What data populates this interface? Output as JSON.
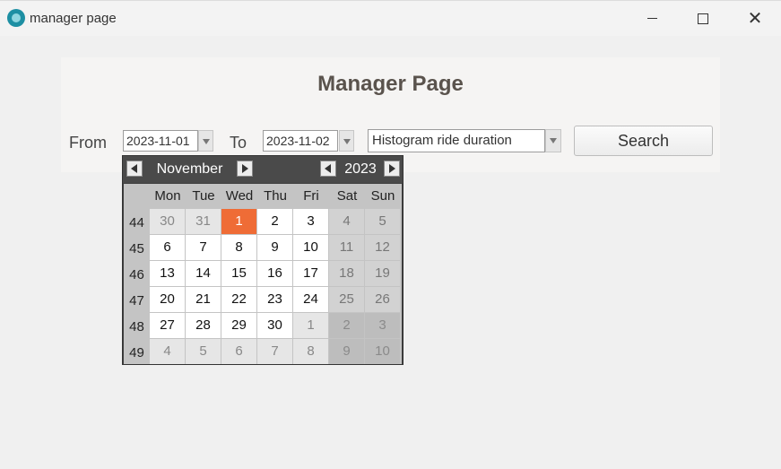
{
  "window": {
    "title": "manager page",
    "icon": "app-logo-icon",
    "controls": {
      "minimize": "minimize-icon",
      "maximize": "maximize-icon",
      "close": "close-icon"
    }
  },
  "page": {
    "title": "Manager Page",
    "from_label": "From",
    "to_label": "To",
    "from_date": "2023-11-01",
    "to_date": "2023-11-02",
    "report_type": "Histogram ride duration",
    "search_label": "Search"
  },
  "calendar": {
    "month": "November",
    "year": "2023",
    "weekday_headers": [
      "Mon",
      "Tue",
      "Wed",
      "Thu",
      "Fri",
      "Sat",
      "Sun"
    ],
    "selected_day": "1",
    "colors": {
      "selected": "#ef6c36",
      "header": "#4a4a4a"
    },
    "weeks": [
      {
        "week": "44",
        "days": [
          {
            "d": "30",
            "in": false
          },
          {
            "d": "31",
            "in": false
          },
          {
            "d": "1",
            "in": true
          },
          {
            "d": "2",
            "in": true
          },
          {
            "d": "3",
            "in": true
          },
          {
            "d": "4",
            "in": true
          },
          {
            "d": "5",
            "in": true
          }
        ]
      },
      {
        "week": "45",
        "days": [
          {
            "d": "6",
            "in": true
          },
          {
            "d": "7",
            "in": true
          },
          {
            "d": "8",
            "in": true
          },
          {
            "d": "9",
            "in": true
          },
          {
            "d": "10",
            "in": true
          },
          {
            "d": "11",
            "in": true
          },
          {
            "d": "12",
            "in": true
          }
        ]
      },
      {
        "week": "46",
        "days": [
          {
            "d": "13",
            "in": true
          },
          {
            "d": "14",
            "in": true
          },
          {
            "d": "15",
            "in": true
          },
          {
            "d": "16",
            "in": true
          },
          {
            "d": "17",
            "in": true
          },
          {
            "d": "18",
            "in": true
          },
          {
            "d": "19",
            "in": true
          }
        ]
      },
      {
        "week": "47",
        "days": [
          {
            "d": "20",
            "in": true
          },
          {
            "d": "21",
            "in": true
          },
          {
            "d": "22",
            "in": true
          },
          {
            "d": "23",
            "in": true
          },
          {
            "d": "24",
            "in": true
          },
          {
            "d": "25",
            "in": true
          },
          {
            "d": "26",
            "in": true
          }
        ]
      },
      {
        "week": "48",
        "days": [
          {
            "d": "27",
            "in": true
          },
          {
            "d": "28",
            "in": true
          },
          {
            "d": "29",
            "in": true
          },
          {
            "d": "30",
            "in": true
          },
          {
            "d": "1",
            "in": false
          },
          {
            "d": "2",
            "in": false
          },
          {
            "d": "3",
            "in": false
          }
        ]
      },
      {
        "week": "49",
        "days": [
          {
            "d": "4",
            "in": false
          },
          {
            "d": "5",
            "in": false
          },
          {
            "d": "6",
            "in": false
          },
          {
            "d": "7",
            "in": false
          },
          {
            "d": "8",
            "in": false
          },
          {
            "d": "9",
            "in": false
          },
          {
            "d": "10",
            "in": false
          }
        ]
      }
    ]
  }
}
